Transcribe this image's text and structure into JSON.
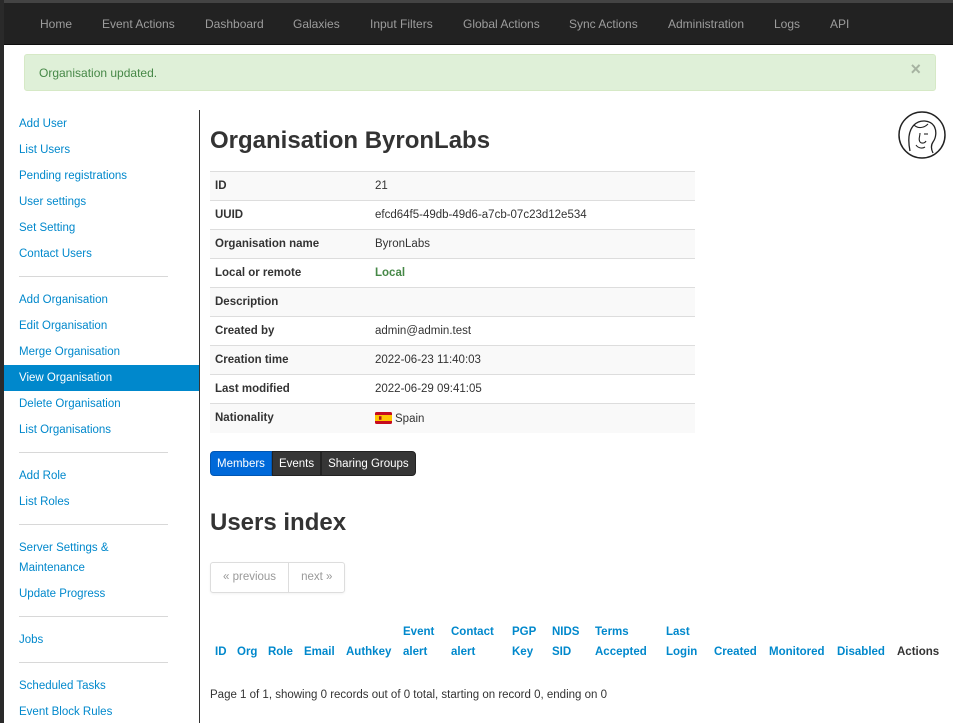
{
  "navbar": {
    "items": [
      "Home",
      "Event Actions",
      "Dashboard",
      "Galaxies",
      "Input Filters",
      "Global Actions",
      "Sync Actions",
      "Administration",
      "Logs",
      "API"
    ]
  },
  "alert": {
    "message": "Organisation updated.",
    "close_label": "×"
  },
  "sidebar": {
    "items": [
      "Add User",
      "List Users",
      "Pending registrations",
      "User settings",
      "Set Setting",
      "Contact Users",
      "Add Organisation",
      "Edit Organisation",
      "Merge Organisation",
      "View Organisation",
      "Delete Organisation",
      "List Organisations",
      "Add Role",
      "List Roles",
      "Server Settings &",
      "Maintenance",
      "Update Progress",
      "Jobs",
      "Scheduled Tasks",
      "Event Block Rules"
    ],
    "active": "View Organisation"
  },
  "org": {
    "title": "Organisation ByronLabs",
    "rows": [
      {
        "label": "ID",
        "value": "21"
      },
      {
        "label": "UUID",
        "value": "efcd64f5-49db-49d6-a7cb-07c23d12e534"
      },
      {
        "label": "Organisation name",
        "value": "ByronLabs"
      },
      {
        "label": "Local or remote",
        "value": "Local"
      },
      {
        "label": "Description",
        "value": ""
      },
      {
        "label": "Created by",
        "value": "admin@admin.test"
      },
      {
        "label": "Creation time",
        "value": "2022-06-23 11:40:03"
      },
      {
        "label": "Last modified",
        "value": "2022-06-29 09:41:05"
      },
      {
        "label": "Nationality",
        "value": "Spain"
      }
    ]
  },
  "tabs": [
    "Members",
    "Events",
    "Sharing Groups"
  ],
  "users_index": {
    "title": "Users index",
    "pager": {
      "prev": "« previous",
      "next": "next »"
    },
    "headers": [
      {
        "top": "",
        "bottom": "ID"
      },
      {
        "top": "",
        "bottom": "Org"
      },
      {
        "top": "",
        "bottom": "Role"
      },
      {
        "top": "",
        "bottom": "Email"
      },
      {
        "top": "",
        "bottom": "Authkey"
      },
      {
        "top": "Event",
        "bottom": "alert"
      },
      {
        "top": "Contact",
        "bottom": "alert"
      },
      {
        "top": "PGP",
        "bottom": "Key"
      },
      {
        "top": "NIDS",
        "bottom": "SID"
      },
      {
        "top": "Terms",
        "bottom": "Accepted"
      },
      {
        "top": "Last",
        "bottom": "Login"
      },
      {
        "top": "",
        "bottom": "Created"
      },
      {
        "top": "",
        "bottom": "Monitored"
      },
      {
        "top": "",
        "bottom": "Disabled"
      },
      {
        "top": "",
        "bottom": "Actions"
      }
    ],
    "summary": "Page 1 of 1, showing 0 records out of 0 total, starting on record 0, ending on 0"
  },
  "colors": {
    "link": "#0088cc",
    "navbar": "#222222",
    "success_bg": "#dff0d8",
    "success_text": "#468847",
    "active_tab": "#0069d9"
  },
  "icons": {
    "alert_close": "close-icon",
    "logo": "misp-avatar-logo",
    "flag": "spain-flag-icon"
  }
}
